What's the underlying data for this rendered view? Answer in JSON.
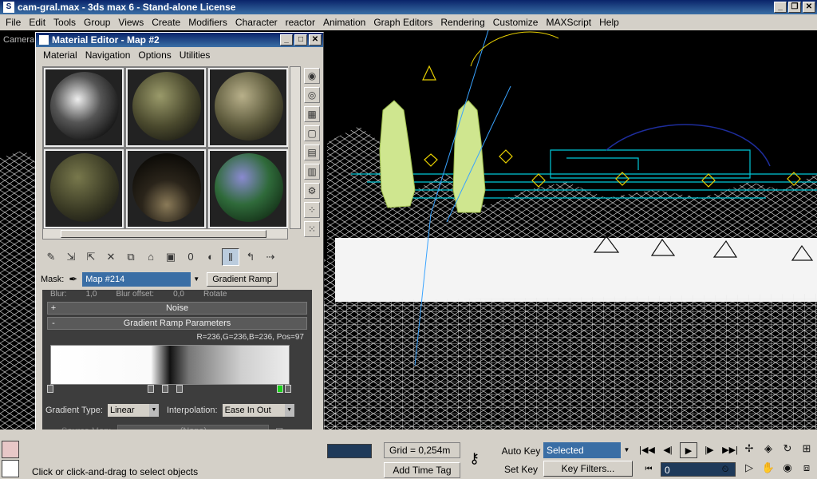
{
  "window": {
    "title": "cam-gral.max - 3ds max 6 - Stand-alone License",
    "app_icon": "3ds-max-icon",
    "buttons": [
      "_",
      "❐",
      "✕"
    ]
  },
  "menu": [
    "File",
    "Edit",
    "Tools",
    "Group",
    "Views",
    "Create",
    "Modifiers",
    "Character",
    "reactor",
    "Animation",
    "Graph Editors",
    "Rendering",
    "Customize",
    "MAXScript",
    "Help"
  ],
  "viewport": {
    "label": "Camera"
  },
  "material_editor": {
    "title": "Material Editor - Map #2",
    "buttons": [
      "_",
      "□",
      "✕"
    ],
    "menu": [
      "Material",
      "Navigation",
      "Options",
      "Utilities"
    ],
    "mask_label": "Mask:",
    "map_name": "Map #214",
    "map_type_button": "Gradient Ramp",
    "partial_row": [
      "Blur:",
      "1,0",
      "Blur offset:",
      "0,0",
      "Rotate"
    ],
    "rollouts": [
      {
        "sign": "+",
        "title": "Noise"
      },
      {
        "sign": "-",
        "title": "Gradient Ramp Parameters"
      }
    ],
    "rgb_readout": "R=236,G=236,B=236, Pos=97",
    "gradient_type_label": "Gradient Type:",
    "gradient_type_value": "Linear",
    "interpolation_label": "Interpolation:",
    "interpolation_value": "Ease In Out",
    "source_map_label": "Source Map:",
    "source_map_value": "(None)"
  },
  "bottom": {
    "status": "Click or click-and-drag to select objects",
    "grid": "Grid = 0,254m",
    "add_time_tag": "Add Time Tag",
    "auto_key": "Auto Key",
    "set_key": "Set Key",
    "selected": "Selected",
    "key_filters": "Key Filters...",
    "frame": "0"
  },
  "colors": {
    "titlebar": "#0a246a",
    "ui_gray": "#d4d0c8",
    "gradient_flag_selected": "#1bd21b",
    "wireframe_cyan": "#00c8d8",
    "wireframe_yellow": "#e8d000"
  }
}
